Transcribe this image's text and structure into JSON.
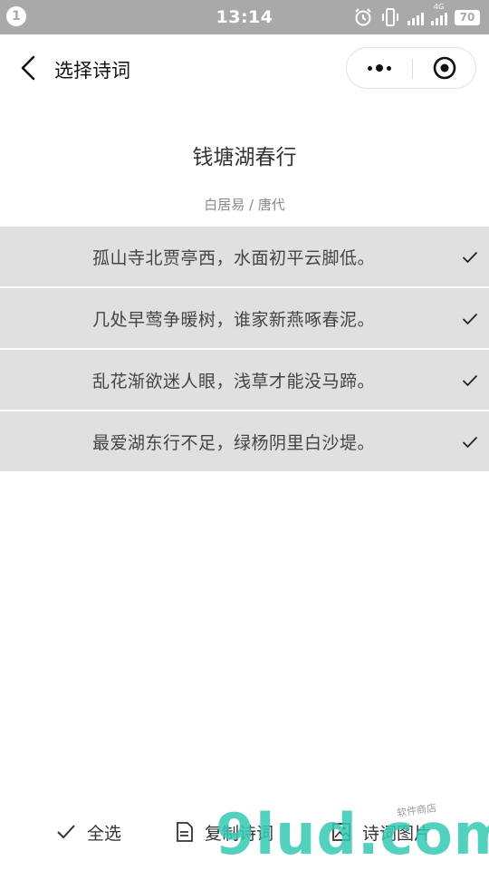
{
  "status_bar": {
    "notification_count": "1",
    "time": "13:14",
    "network_label": "4G",
    "battery": "70"
  },
  "nav": {
    "title": "选择诗词"
  },
  "poem": {
    "title": "钱塘湖春行",
    "author_line": "白居易 / 唐代",
    "lines": [
      {
        "text": "孤山寺北贾亭西，水面初平云脚低。",
        "checked": true
      },
      {
        "text": "几处早莺争暖树，谁家新燕啄春泥。",
        "checked": true
      },
      {
        "text": "乱花渐欲迷人眼，浅草才能没马蹄。",
        "checked": true
      },
      {
        "text": "最爱湖东行不足，绿杨阴里白沙堤。",
        "checked": true
      }
    ]
  },
  "toolbar": {
    "select_all_label": "全选",
    "copy_label": "复制诗词",
    "image_label": "诗词图片"
  },
  "watermark": {
    "main": "9lud.com",
    "sub": "软件商店"
  },
  "colors": {
    "status_bar": "#a9a9a9",
    "row_bg": "#e0e0e0",
    "watermark": "#36c9b4"
  }
}
